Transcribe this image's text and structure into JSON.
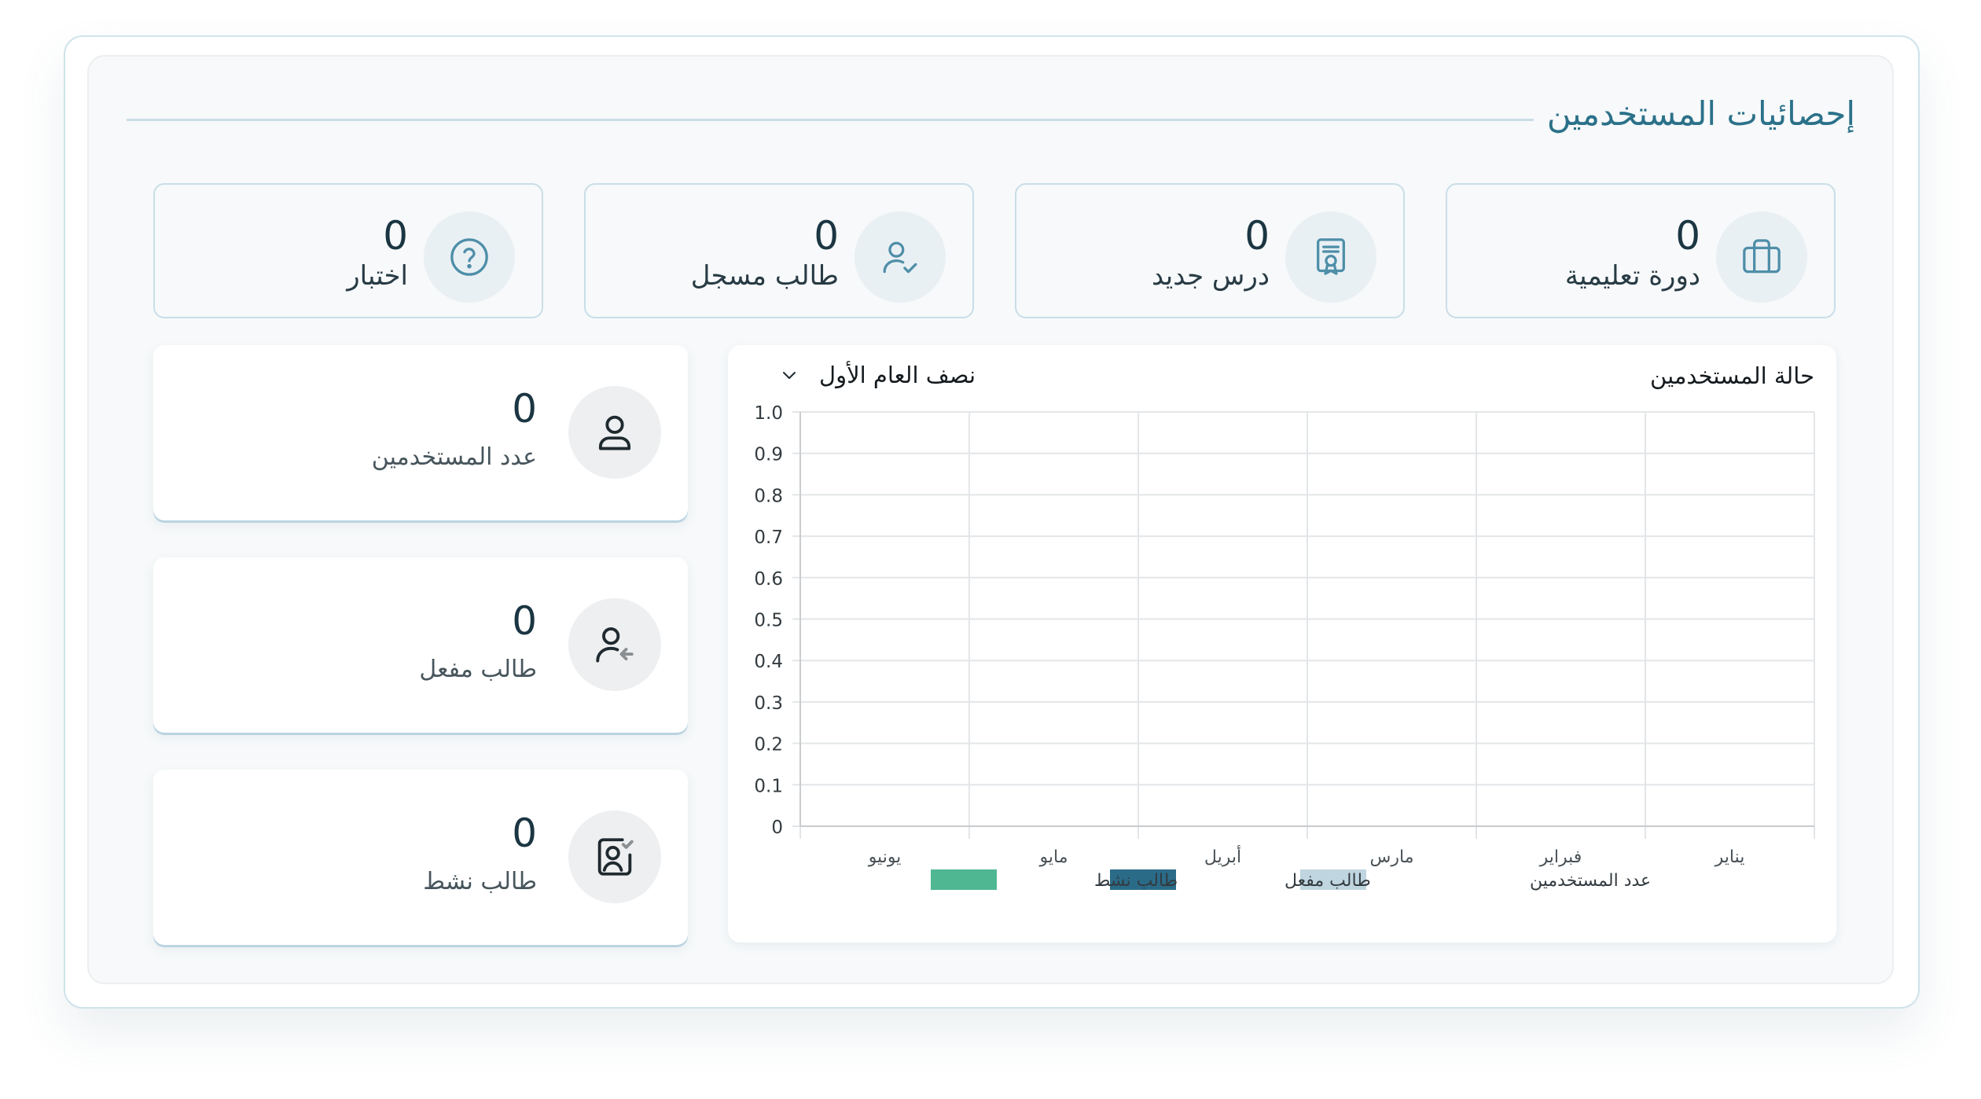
{
  "section": {
    "title": "إحصائيات المستخدمين"
  },
  "top_stats": [
    {
      "value": "0",
      "label": "دورة تعليمية",
      "icon": "briefcase-icon"
    },
    {
      "value": "0",
      "label": "درس جديد",
      "icon": "certificate-icon"
    },
    {
      "value": "0",
      "label": "طالب مسجل",
      "icon": "user-check-icon"
    },
    {
      "value": "0",
      "label": "اختبار",
      "icon": "question-circle-icon"
    }
  ],
  "user_stats": [
    {
      "value": "0",
      "label": "عدد المستخدمين",
      "icon": "user-icon"
    },
    {
      "value": "0",
      "label": "طالب مفعل",
      "icon": "user-arrow-icon"
    },
    {
      "value": "0",
      "label": "طالب نشط",
      "icon": "user-card-check-icon"
    }
  ],
  "chart_panel": {
    "title": "حالة المستخدمين",
    "period": "نصف العام الأول"
  },
  "colors": {
    "accent": "#2b7189",
    "users_count": "#bfd5df",
    "activated_student": "#2a6b88",
    "active_student": "#4fb893"
  },
  "chart_data": {
    "type": "bar",
    "title": "حالة المستخدمين",
    "categories": [
      "يناير",
      "فبراير",
      "مارس",
      "أبريل",
      "مايو",
      "يونيو"
    ],
    "series": [
      {
        "name": "عدد المستخدمين",
        "values": [
          0,
          0,
          0,
          0,
          0,
          0
        ],
        "color": "#bfd5df"
      },
      {
        "name": "طالب مفعل",
        "values": [
          0,
          0,
          0,
          0,
          0,
          0
        ],
        "color": "#2a6b88"
      },
      {
        "name": "طالب نشط",
        "values": [
          0,
          0,
          0,
          0,
          0,
          0
        ],
        "color": "#4fb893"
      }
    ],
    "ylim": [
      0,
      1
    ],
    "yticks": [
      "0",
      "0.1",
      "0.2",
      "0.3",
      "0.4",
      "0.5",
      "0.6",
      "0.7",
      "0.8",
      "0.9",
      "1.0"
    ],
    "xlabel": "",
    "ylabel": "",
    "grid": true,
    "legend": "bottom",
    "x_direction": "right-to-left"
  }
}
